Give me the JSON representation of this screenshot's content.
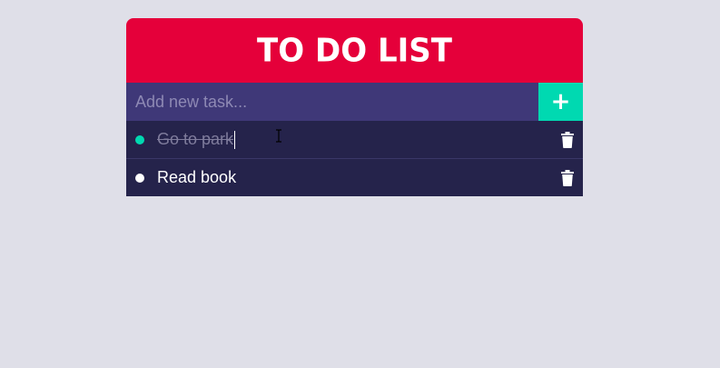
{
  "header": {
    "title": "TO DO LIST"
  },
  "input": {
    "placeholder": "Add new task...",
    "value": ""
  },
  "add_button": {
    "label": "+"
  },
  "tasks": [
    {
      "text": "Go to park",
      "done": true,
      "delete_icon": "trash-icon"
    },
    {
      "text": "Read book",
      "done": false,
      "delete_icon": "trash-icon"
    }
  ],
  "colors": {
    "header_bg": "#e5003a",
    "input_bg": "#3f3878",
    "add_button_bg": "#00d9b1",
    "list_bg": "#25234b",
    "page_bg": "#dfdfe8"
  }
}
